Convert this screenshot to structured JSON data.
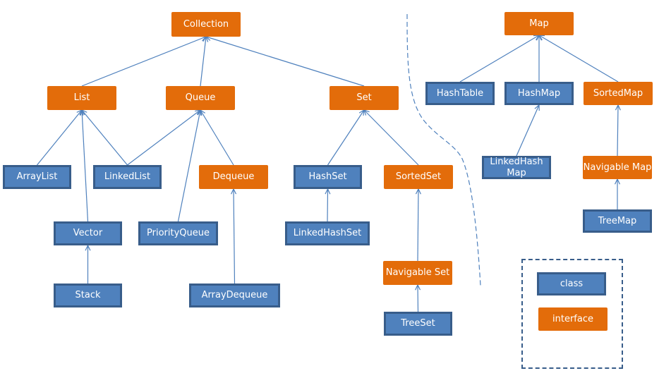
{
  "colors": {
    "interface": "#E36C0A",
    "class": "#4F81BD",
    "class_border": "#385D8A",
    "edge": "#4F81BD"
  },
  "nodes": {
    "collection": {
      "label": "Collection",
      "kind": "interface"
    },
    "list": {
      "label": "List",
      "kind": "interface"
    },
    "queue": {
      "label": "Queue",
      "kind": "interface"
    },
    "set": {
      "label": "Set",
      "kind": "interface"
    },
    "arraylist": {
      "label": "ArrayList",
      "kind": "class"
    },
    "linkedlist": {
      "label": "LinkedList",
      "kind": "class"
    },
    "dequeue": {
      "label": "Dequeue",
      "kind": "interface"
    },
    "hashset": {
      "label": "HashSet",
      "kind": "class"
    },
    "sortedset": {
      "label": "SortedSet",
      "kind": "interface"
    },
    "vector": {
      "label": "Vector",
      "kind": "class"
    },
    "priorityqueue": {
      "label": "PriorityQueue",
      "kind": "class"
    },
    "linkedhashset": {
      "label": "LinkedHashSet",
      "kind": "class"
    },
    "stack": {
      "label": "Stack",
      "kind": "class"
    },
    "arraydequeue": {
      "label": "ArrayDequeue",
      "kind": "class"
    },
    "navigableset": {
      "label": "Navigable Set",
      "kind": "interface"
    },
    "treeset": {
      "label": "TreeSet",
      "kind": "class"
    },
    "map": {
      "label": "Map",
      "kind": "interface"
    },
    "hashtable": {
      "label": "HashTable",
      "kind": "class"
    },
    "hashmap": {
      "label": "HashMap",
      "kind": "class"
    },
    "sortedmap": {
      "label": "SortedMap",
      "kind": "interface"
    },
    "linkedhashmap": {
      "label": "LinkedHash Map",
      "kind": "class"
    },
    "navigablemap": {
      "label": "Navigable Map",
      "kind": "interface"
    },
    "treemap": {
      "label": "TreeMap",
      "kind": "class"
    }
  },
  "edges": [
    [
      "list",
      "collection"
    ],
    [
      "queue",
      "collection"
    ],
    [
      "set",
      "collection"
    ],
    [
      "arraylist",
      "list"
    ],
    [
      "vector",
      "list"
    ],
    [
      "linkedlist",
      "list"
    ],
    [
      "linkedlist",
      "queue"
    ],
    [
      "priorityqueue",
      "queue"
    ],
    [
      "dequeue",
      "queue"
    ],
    [
      "stack",
      "vector"
    ],
    [
      "arraydequeue",
      "dequeue"
    ],
    [
      "hashset",
      "set"
    ],
    [
      "sortedset",
      "set"
    ],
    [
      "linkedhashset",
      "hashset"
    ],
    [
      "navigableset",
      "sortedset"
    ],
    [
      "treeset",
      "navigableset"
    ],
    [
      "hashtable",
      "map"
    ],
    [
      "hashmap",
      "map"
    ],
    [
      "sortedmap",
      "map"
    ],
    [
      "linkedhashmap",
      "hashmap"
    ],
    [
      "navigablemap",
      "sortedmap"
    ],
    [
      "treemap",
      "navigablemap"
    ]
  ],
  "legend": {
    "class_label": "class",
    "interface_label": "interface"
  }
}
